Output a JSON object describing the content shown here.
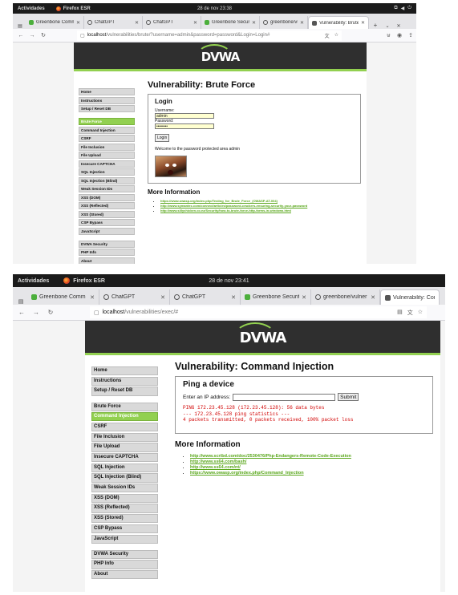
{
  "shot1": {
    "gnome": {
      "activities": "Actividades",
      "browser": "Firefox ESR",
      "clock": "28 de nov  23:38"
    },
    "tabs": [
      {
        "title": "Greenbone Comm",
        "icon": "greenbone-icon"
      },
      {
        "title": "ChatGPT",
        "icon": "chatgpt-icon"
      },
      {
        "title": "ChatGPT",
        "icon": "chatgpt-icon"
      },
      {
        "title": "Greenbone Securit",
        "icon": "greenbone-icon"
      },
      {
        "title": "greenbone/vulner",
        "icon": "github-icon"
      },
      {
        "title": "Vulnerability: Brute",
        "icon": "dvwa-icon"
      }
    ],
    "url": {
      "host": "localhost",
      "path": "/vulnerabilities/brute/?username=admin&password=password&Login=Login#"
    },
    "logo": "DVWA",
    "menu": {
      "group1": [
        "Home",
        "Instructions",
        "Setup / Reset DB"
      ],
      "group2": [
        "Brute Force",
        "Command Injection",
        "CSRF",
        "File Inclusion",
        "File Upload",
        "Insecure CAPTCHA",
        "SQL Injection",
        "SQL Injection (Blind)",
        "Weak Session IDs",
        "XSS (DOM)",
        "XSS (Reflected)",
        "XSS (Stored)",
        "CSP Bypass",
        "JavaScript"
      ],
      "group3": [
        "DVWA Security",
        "PHP Info",
        "About"
      ]
    },
    "title": "Vulnerability: Brute Force",
    "login": {
      "heading": "Login",
      "username_label": "Username:",
      "username_value": "admin",
      "password_label": "Password:",
      "password_value": "••••••••",
      "button": "Login",
      "message": "Welcome to the password protected area admin"
    },
    "more_info": {
      "heading": "More Information",
      "links": [
        "https://www.owasp.org/index.php/Testing_for_Brute_Force_(OWASP-AT-004)",
        "http://www.symantec.com/connect/articles/password-crackers-ensuring-security-your-password",
        "http://www.sillychicken.co.nz/Security/how-to-brute-force-http-forms-in-windows.html"
      ]
    }
  },
  "shot2": {
    "gnome": {
      "activities": "Actividades",
      "browser": "Firefox ESR",
      "clock": "28 de nov  23:41"
    },
    "tabs": [
      {
        "title": "Greenbone Comm",
        "icon": "greenbone-icon"
      },
      {
        "title": "ChatGPT",
        "icon": "chatgpt-icon"
      },
      {
        "title": "ChatGPT",
        "icon": "chatgpt-icon"
      },
      {
        "title": "Greenbone Securit",
        "icon": "greenbone-icon"
      },
      {
        "title": "greenbone/vulner",
        "icon": "github-icon"
      },
      {
        "title": "Vulnerability: Com",
        "icon": "dvwa-icon"
      }
    ],
    "url": {
      "host": "localhost",
      "path": "/vulnerabilities/exec/#"
    },
    "logo": "DVWA",
    "menu": {
      "group1": [
        "Home",
        "Instructions",
        "Setup / Reset DB"
      ],
      "group2": [
        "Brute Force",
        "Command Injection",
        "CSRF",
        "File Inclusion",
        "File Upload",
        "Insecure CAPTCHA",
        "SQL Injection",
        "SQL Injection (Blind)",
        "Weak Session IDs",
        "XSS (DOM)",
        "XSS (Reflected)",
        "XSS (Stored)",
        "CSP Bypass",
        "JavaScript"
      ],
      "group3": [
        "DVWA Security",
        "PHP Info",
        "About"
      ]
    },
    "title": "Vulnerability: Command Injection",
    "ping": {
      "heading": "Ping a device",
      "label": "Enter an IP address:",
      "input_value": "",
      "button": "Submit",
      "output": "PING 172.23.45.128 (172.23.45.128): 56 data bytes\n--- 172.23.45.128 ping statistics ---\n4 packets transmitted, 0 packets received, 100% packet loss"
    },
    "more_info": {
      "heading": "More Information",
      "links": [
        "http://www.scribd.com/doc/2530476/Php-Endangers-Remote-Code-Execution",
        "http://www.ss64.com/bash/",
        "http://www.ss64.com/nt/",
        "https://www.owasp.org/index.php/Command_Injection"
      ]
    }
  },
  "colors": {
    "dvwa_green": "#92d050",
    "header_dark": "#2f2f2f",
    "error_red": "#d10000"
  }
}
